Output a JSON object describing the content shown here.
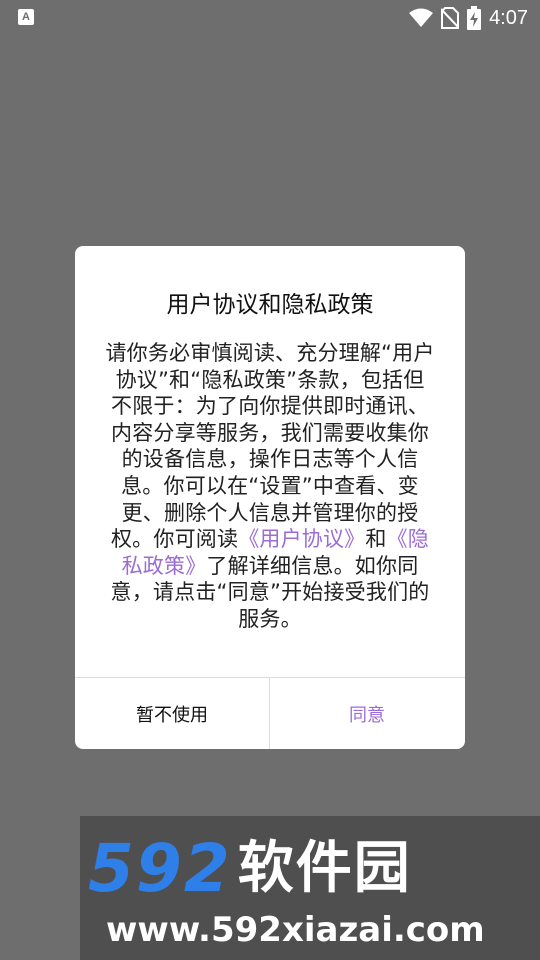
{
  "status_bar": {
    "app_icon_letter": "A",
    "time": "4:07",
    "icons": [
      "app-notification-icon",
      "wifi-icon",
      "no-sim-icon",
      "battery-charging-icon"
    ]
  },
  "dialog": {
    "title": "用户协议和隐私政策",
    "body": {
      "text_before": "请你务必审慎阅读、充分理解“用户协议”和“隐私政策”条款，包括但不限于：为了向你提供即时通讯、内容分享等服务，我们需要收集你的设备信息，操作日志等个人信息。你可以在“设置”中查看、变更、删除个人信息并管理你的授权。你可阅读",
      "link_user_agreement": "《用户协议》",
      "text_and": "和",
      "link_privacy_policy": "《隐私政策》",
      "text_after": "了解详细信息。如你同意，请点击“同意”开始接受我们的服务。"
    },
    "decline_label": "暂不使用",
    "agree_label": "同意"
  },
  "watermark": {
    "logo_number": "592",
    "logo_name": "软件园",
    "url": "www.592xiazai.com"
  },
  "colors": {
    "overlay": "#6e6e6e",
    "link": "#9b6bd6",
    "watermark_blue": "#2f7fe8"
  }
}
